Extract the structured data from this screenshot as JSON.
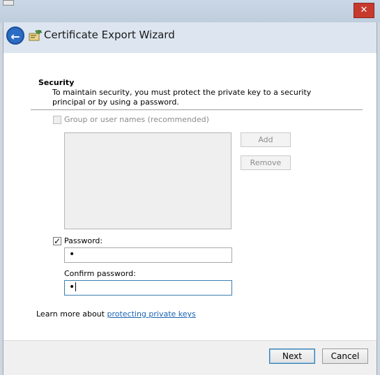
{
  "wizard": {
    "title": "Certificate Export Wizard",
    "back_icon": "back-arrow-icon",
    "wizard_icon": "certificate-wizard-icon"
  },
  "security": {
    "heading": "Security",
    "description": "To maintain security, you must protect the private key to a security principal or by using a password.",
    "group_checkbox": {
      "label": "Group or user names (recommended)",
      "checked": false,
      "enabled": false
    },
    "add_label": "Add",
    "remove_label": "Remove"
  },
  "password": {
    "checkbox_label": "Password:",
    "checked": true,
    "value_mask": "•",
    "confirm_label": "Confirm password:",
    "confirm_value_mask": "•"
  },
  "learn_more": {
    "prefix": "Learn more about ",
    "link_text": "protecting private keys"
  },
  "footer": {
    "next_label": "Next",
    "cancel_label": "Cancel"
  },
  "colors": {
    "accent": "#2b6cc4",
    "link": "#1b62b4",
    "header_bg": "#dde6f0",
    "footer_bg": "#f0f0f0"
  }
}
